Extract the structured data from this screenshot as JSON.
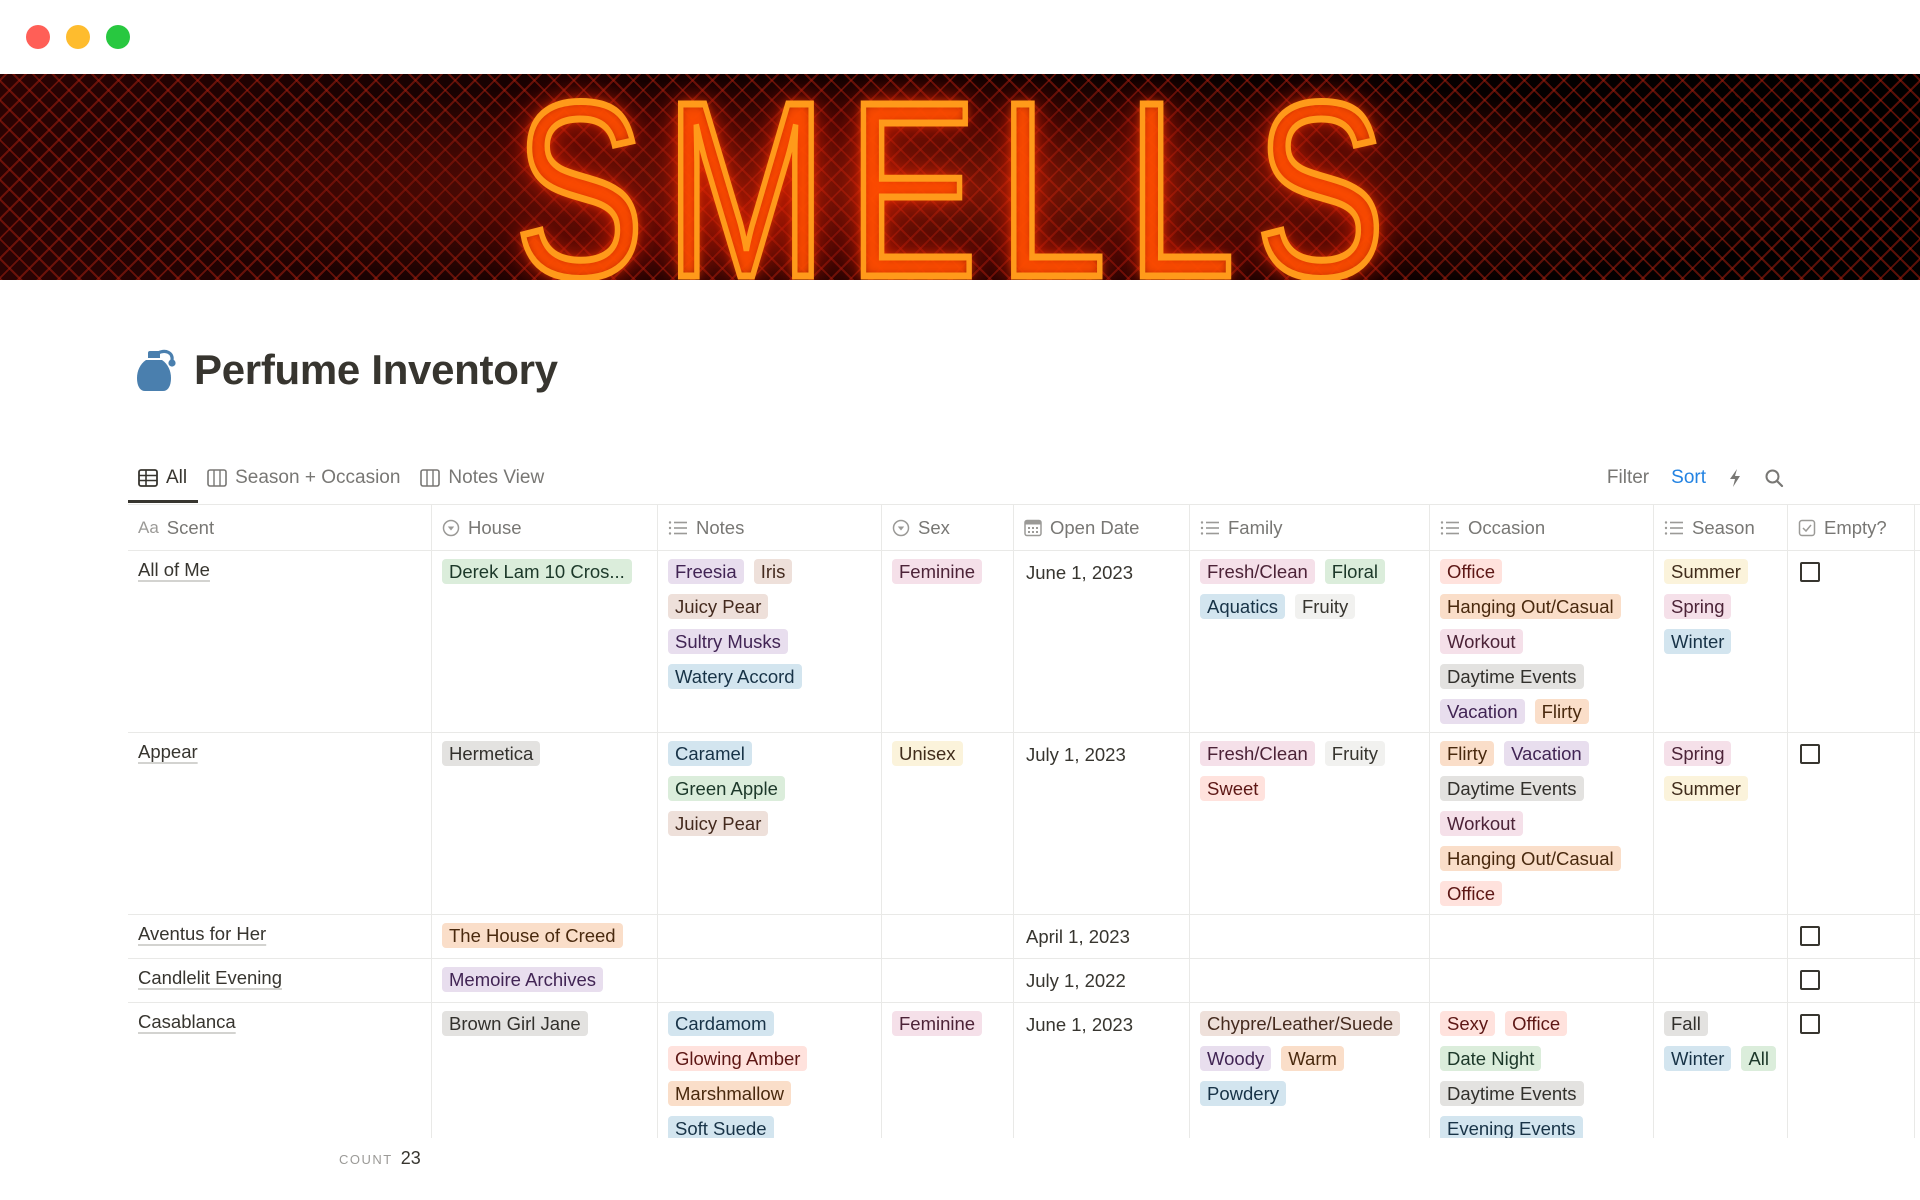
{
  "window": {
    "controls": [
      "close",
      "minimize",
      "maximize"
    ]
  },
  "cover": {
    "text": "SMELLS",
    "description": "neon sign cover image"
  },
  "page": {
    "icon": "perfume-bottle-icon",
    "title": "Perfume Inventory"
  },
  "views": [
    {
      "label": "All",
      "icon": "table-icon",
      "active": true
    },
    {
      "label": "Season + Occasion",
      "icon": "board-icon",
      "active": false
    },
    {
      "label": "Notes View",
      "icon": "board-icon",
      "active": false
    }
  ],
  "toolbar": {
    "filter_label": "Filter",
    "sort_label": "Sort",
    "automation_icon": "lightning-icon",
    "search_icon": "search-icon",
    "sort_color": "#2383e2"
  },
  "columns": [
    {
      "label": "Scent",
      "icon": "Aa"
    },
    {
      "label": "House",
      "icon": "select-icon"
    },
    {
      "label": "Notes",
      "icon": "list-icon"
    },
    {
      "label": "Sex",
      "icon": "select-icon"
    },
    {
      "label": "Open Date",
      "icon": "calendar-icon"
    },
    {
      "label": "Family",
      "icon": "list-icon"
    },
    {
      "label": "Occasion",
      "icon": "list-icon"
    },
    {
      "label": "Season",
      "icon": "list-icon"
    },
    {
      "label": "Empty?",
      "icon": "checkbox-icon"
    }
  ],
  "rows": [
    {
      "scent": "All of Me",
      "house": {
        "label": "Derek Lam 10 Cros...",
        "color": "green"
      },
      "notes": [
        {
          "label": "Freesia",
          "color": "purple"
        },
        {
          "label": "Iris",
          "color": "brown"
        },
        {
          "label": "Juicy Pear",
          "color": "brown"
        },
        {
          "label": "Sultry Musks",
          "color": "purple"
        },
        {
          "label": "Watery Accord",
          "color": "blue"
        }
      ],
      "sex": {
        "label": "Feminine",
        "color": "pink"
      },
      "open_date": "June 1, 2023",
      "family": [
        {
          "label": "Fresh/Clean",
          "color": "pink"
        },
        {
          "label": "Floral",
          "color": "green"
        },
        {
          "label": "Aquatics",
          "color": "blue"
        },
        {
          "label": "Fruity",
          "color": "light"
        }
      ],
      "occasion": [
        {
          "label": "Office",
          "color": "red"
        },
        {
          "label": "Hanging Out/Casual",
          "color": "orange"
        },
        {
          "label": "Workout",
          "color": "pink"
        },
        {
          "label": "Daytime Events",
          "color": "gray"
        },
        {
          "label": "Vacation",
          "color": "purple"
        },
        {
          "label": "Flirty",
          "color": "orange"
        }
      ],
      "season": [
        {
          "label": "Summer",
          "color": "yellow"
        },
        {
          "label": "Spring",
          "color": "pink"
        },
        {
          "label": "Winter",
          "color": "blue"
        }
      ],
      "empty": false
    },
    {
      "scent": "Appear",
      "house": {
        "label": "Hermetica",
        "color": "gray"
      },
      "notes": [
        {
          "label": "Caramel",
          "color": "blue"
        },
        {
          "label": "Green Apple",
          "color": "green"
        },
        {
          "label": "Juicy Pear",
          "color": "brown"
        }
      ],
      "sex": {
        "label": "Unisex",
        "color": "yellow"
      },
      "open_date": "July 1, 2023",
      "family": [
        {
          "label": "Fresh/Clean",
          "color": "pink"
        },
        {
          "label": "Fruity",
          "color": "light"
        },
        {
          "label": "Sweet",
          "color": "red"
        }
      ],
      "occasion": [
        {
          "label": "Flirty",
          "color": "orange"
        },
        {
          "label": "Vacation",
          "color": "purple"
        },
        {
          "label": "Daytime Events",
          "color": "gray"
        },
        {
          "label": "Workout",
          "color": "pink"
        },
        {
          "label": "Hanging Out/Casual",
          "color": "orange"
        },
        {
          "label": "Office",
          "color": "red"
        }
      ],
      "season": [
        {
          "label": "Spring",
          "color": "pink"
        },
        {
          "label": "Summer",
          "color": "yellow"
        }
      ],
      "empty": false
    },
    {
      "scent": "Aventus for Her",
      "house": {
        "label": "The House of Creed",
        "color": "orange"
      },
      "notes": [],
      "sex": null,
      "open_date": "April 1, 2023",
      "family": [],
      "occasion": [],
      "season": [],
      "empty": false
    },
    {
      "scent": "Candlelit Evening",
      "house": {
        "label": "Memoire Archives",
        "color": "purple"
      },
      "notes": [],
      "sex": null,
      "open_date": "July 1, 2022",
      "family": [],
      "occasion": [],
      "season": [],
      "empty": false
    },
    {
      "scent": "Casablanca",
      "house": {
        "label": "Brown Girl Jane",
        "color": "gray"
      },
      "notes": [
        {
          "label": "Cardamom",
          "color": "blue"
        },
        {
          "label": "Glowing Amber",
          "color": "red"
        },
        {
          "label": "Marshmallow",
          "color": "orange"
        },
        {
          "label": "Soft Suede",
          "color": "blue"
        }
      ],
      "sex": {
        "label": "Feminine",
        "color": "pink"
      },
      "open_date": "June 1, 2023",
      "family": [
        {
          "label": "Chypre/Leather/Suede",
          "color": "brown"
        },
        {
          "label": "Woody",
          "color": "purple"
        },
        {
          "label": "Warm",
          "color": "orange"
        },
        {
          "label": "Powdery",
          "color": "blue"
        }
      ],
      "occasion": [
        {
          "label": "Sexy",
          "color": "red"
        },
        {
          "label": "Office",
          "color": "red"
        },
        {
          "label": "Date Night",
          "color": "green"
        },
        {
          "label": "Daytime Events",
          "color": "gray"
        },
        {
          "label": "Evening Events",
          "color": "blue"
        }
      ],
      "season": [
        {
          "label": "Fall",
          "color": "gray"
        },
        {
          "label": "Winter",
          "color": "blue"
        },
        {
          "label": "All",
          "color": "green"
        }
      ],
      "empty": false
    }
  ],
  "footer": {
    "count_label": "COUNT",
    "count_value": "23"
  }
}
